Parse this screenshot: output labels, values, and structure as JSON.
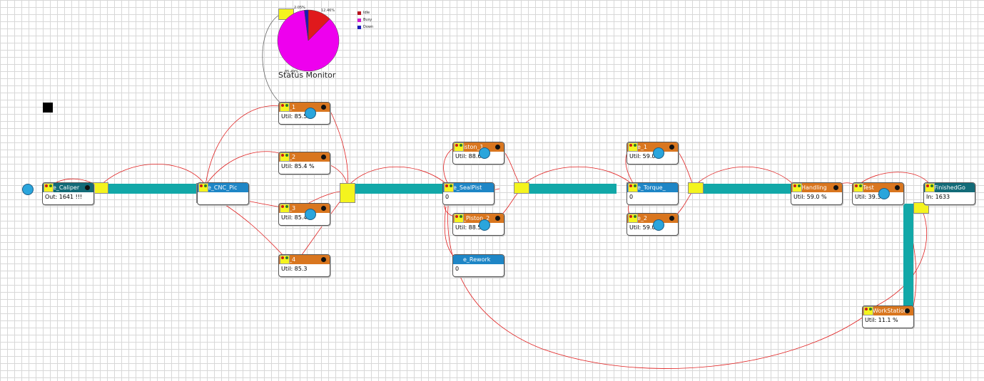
{
  "status_monitor": {
    "title": "Status Monitor",
    "slices": [
      {
        "name": "Idle",
        "percent_label": "12.46%",
        "value": 12.46,
        "color": "#e0191c"
      },
      {
        "name": "Busy",
        "percent_label": "85.49%",
        "value": 85.49,
        "color": "#ee00ee"
      },
      {
        "name": "Down",
        "percent_label": "2.05%",
        "value": 2.05,
        "color": "#1a1ab8"
      }
    ]
  },
  "blocks": {
    "source": {
      "title": "e_Caliper",
      "stat": "Out: 1641 !!!"
    },
    "cnc_buffer": {
      "title": "e_CNC_Pic",
      "stat": ""
    },
    "m1": {
      "title": "_1",
      "stat": "Util: 85.5"
    },
    "m2": {
      "title": "_2",
      "stat": "Util: 85.4 %"
    },
    "m3": {
      "title": "_3",
      "stat": "Util: 85.4"
    },
    "m4": {
      "title": "_4",
      "stat": "Util: 85.3"
    },
    "piston1": {
      "title": "iston_1",
      "stat": "Util: 88.6"
    },
    "sealpiston_buffer": {
      "title": "e_SealPist",
      "stat": "0"
    },
    "piston2": {
      "title": "_Piston_2",
      "stat": "Util: 88.5"
    },
    "rework_buffer": {
      "title": "e_Rework",
      "stat": "0"
    },
    "torque1": {
      "title": "e_1",
      "stat": "Util: 59.0"
    },
    "torque_buffer": {
      "title": "e_Torque_",
      "stat": "0"
    },
    "torque2": {
      "title": "e_2",
      "stat": "Util: 59.0"
    },
    "handling": {
      "title": "Handling",
      "stat": "Util: 59.0 %"
    },
    "test": {
      "title": "Test",
      "stat": "Util: 39.3"
    },
    "finished": {
      "title": "FinishedGo",
      "stat": "In: 1633"
    },
    "workstation": {
      "title": "WorkStation",
      "stat": "Util: 11.1 %"
    }
  }
}
